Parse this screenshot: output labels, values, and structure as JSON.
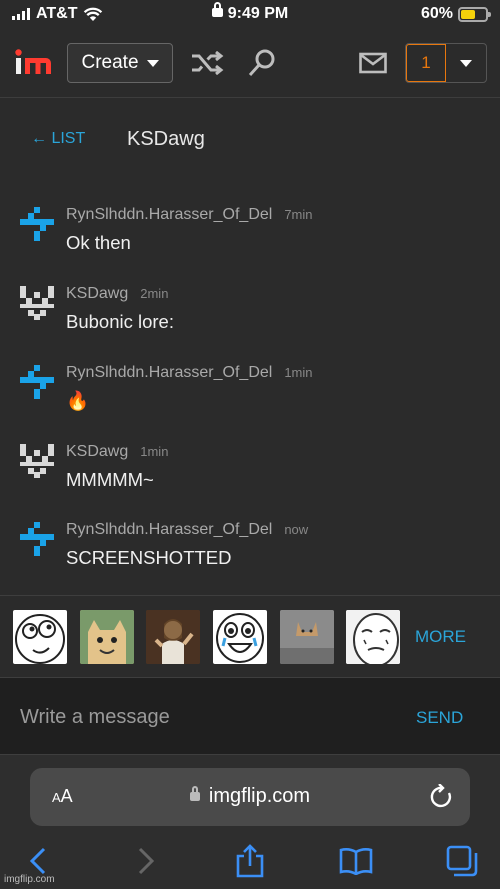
{
  "status_bar": {
    "carrier": "AT&T",
    "time": "9:49 PM",
    "battery_percent": "60%",
    "battery_level": 0.6
  },
  "header": {
    "logo_text": "im",
    "create_label": "Create",
    "notification_count": "1"
  },
  "conversation": {
    "back_label": "← LIST",
    "title": "KSDawg"
  },
  "messages": [
    {
      "author": "RynSlhddn.Harasser_Of_Del",
      "time": "7min",
      "text": "Ok then",
      "avatar": "blue-arrows"
    },
    {
      "author": "KSDawg",
      "time": "2min",
      "text": "Bubonic lore:",
      "avatar": "gray-pixel"
    },
    {
      "author": "RynSlhddn.Harasser_Of_Del",
      "time": "1min",
      "text": "🔥",
      "avatar": "blue-arrows"
    },
    {
      "author": "KSDawg",
      "time": "1min",
      "text": "MMMMM~",
      "avatar": "gray-pixel"
    },
    {
      "author": "RynSlhddn.Harasser_Of_Del",
      "time": "now",
      "text": "SCREENSHOTTED",
      "avatar": "blue-arrows"
    }
  ],
  "memes": {
    "more_label": "MORE",
    "thumbnails": [
      "derp-face",
      "smiling-cat",
      "buddy-christ",
      "crying-happy-face",
      "ceiling-cat",
      "okay-face"
    ]
  },
  "composer": {
    "placeholder": "Write a message",
    "send_label": "SEND"
  },
  "browser": {
    "aa_small": "A",
    "aa_large": "A",
    "domain": "imgflip.com"
  },
  "watermark": "imgflip.com",
  "colors": {
    "accent": "#2ba5d9",
    "notification": "#e8770e",
    "background": "#2b2b2b"
  }
}
